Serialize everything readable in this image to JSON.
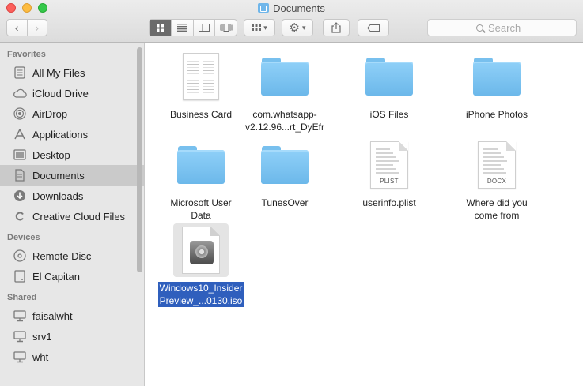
{
  "window": {
    "title": "Documents"
  },
  "toolbar": {
    "back_glyph": "‹",
    "forward_glyph": "›",
    "view_modes": [
      "icon-view",
      "list-view",
      "column-view",
      "cover-flow-view"
    ],
    "active_view": "icon-view",
    "arrange_glyph": "▾",
    "action_glyph": "▾",
    "search_placeholder": "Search"
  },
  "sidebar": {
    "favorites_heading": "Favorites",
    "favorites": [
      {
        "label": "All My Files",
        "icon": "all-files-icon"
      },
      {
        "label": "iCloud Drive",
        "icon": "cloud-icon"
      },
      {
        "label": "AirDrop",
        "icon": "airdrop-icon"
      },
      {
        "label": "Applications",
        "icon": "applications-icon"
      },
      {
        "label": "Desktop",
        "icon": "desktop-icon"
      },
      {
        "label": "Documents",
        "icon": "documents-icon",
        "selected": true
      },
      {
        "label": "Downloads",
        "icon": "downloads-icon"
      },
      {
        "label": "Creative Cloud Files",
        "icon": "creative-cloud-icon"
      }
    ],
    "devices_heading": "Devices",
    "devices": [
      {
        "label": "Remote Disc",
        "icon": "disc-icon"
      },
      {
        "label": "El Capitan",
        "icon": "drive-icon"
      }
    ],
    "shared_heading": "Shared",
    "shared": [
      {
        "label": "faisalwht",
        "icon": "computer-icon"
      },
      {
        "label": "srv1",
        "icon": "computer-icon"
      },
      {
        "label": "wht",
        "icon": "computer-icon"
      }
    ]
  },
  "files": [
    {
      "kind": "sheet",
      "line1": "Business Card",
      "line2": ""
    },
    {
      "kind": "folder",
      "line1": "com.whatsapp-",
      "line2": "v2.12.96...rt_DyEfr"
    },
    {
      "kind": "folder",
      "line1": "iOS Files",
      "line2": ""
    },
    {
      "kind": "folder",
      "line1": "iPhone Photos",
      "line2": ""
    },
    {
      "kind": "folder",
      "line1": "Microsoft User",
      "line2": "Data"
    },
    {
      "kind": "folder",
      "line1": "TunesOver",
      "line2": ""
    },
    {
      "kind": "doc",
      "tag": "PLIST",
      "line1": "userinfo.plist",
      "line2": ""
    },
    {
      "kind": "doc",
      "tag": "DOCX",
      "line1": "Where did you",
      "line2": "come from"
    },
    {
      "kind": "iso",
      "line1": "Windows10_Insider",
      "line2": "Preview_...0130.iso",
      "selected": true
    }
  ]
}
